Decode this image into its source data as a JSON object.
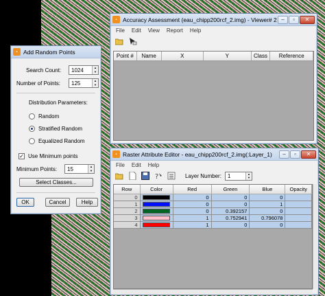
{
  "accuracy_window": {
    "title": "Accuracy Assessment (eau_chipp200rcf_2.img) - Viewer# 2",
    "menu": [
      "File",
      "Edit",
      "View",
      "Report",
      "Help"
    ],
    "columns": [
      "Point #",
      "Name",
      "X",
      "Y",
      "Class",
      "Reference"
    ]
  },
  "raster_window": {
    "title": "Raster Attribute Editor - eau_chipp200rcf_2.img(:Layer_1)",
    "menu": [
      "File",
      "Edit",
      "Help"
    ],
    "layer_label": "Layer Number:",
    "layer_value": "1",
    "columns": [
      "Row",
      "Color",
      "Red",
      "Green",
      "Blue",
      "Opacity"
    ],
    "rows": [
      {
        "row": "0",
        "color": "#000000",
        "red": "0",
        "green": "0",
        "blue": "0"
      },
      {
        "row": "1",
        "color": "#0010ff",
        "red": "0",
        "green": "0",
        "blue": "1"
      },
      {
        "row": "2",
        "color": "#006422",
        "red": "0",
        "green": "0.392157",
        "blue": "0"
      },
      {
        "row": "3",
        "color": "#ffc0cb",
        "red": "1",
        "green": "0.752941",
        "blue": "0.796078"
      },
      {
        "row": "4",
        "color": "#ff0000",
        "red": "1",
        "green": "0",
        "blue": "0"
      }
    ]
  },
  "random_points_dialog": {
    "title": "Add Random Points",
    "search_count_label": "Search Count:",
    "search_count": "1024",
    "num_points_label": "Number of Points:",
    "num_points": "125",
    "distribution_label": "Distribution Parameters:",
    "options": [
      "Random",
      "Stratified Random",
      "Equalized Random"
    ],
    "selected_option": "Stratified Random",
    "use_min_label": "Use Minimum points",
    "min_points_label": "Minimum Points:",
    "min_points": "15",
    "select_classes_label": "Select Classes...",
    "ok_label": "OK",
    "cancel_label": "Cancel",
    "help_label": "Help"
  }
}
